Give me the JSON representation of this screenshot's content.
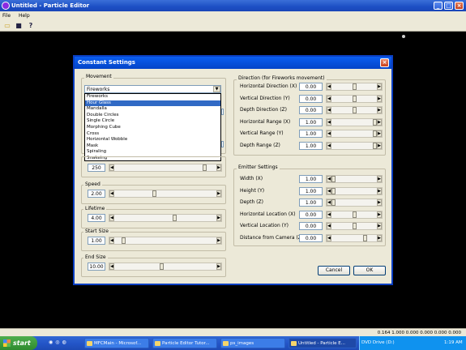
{
  "window": {
    "title": "Untitled - Particle Editor",
    "menu": [
      "File",
      "Help"
    ]
  },
  "toolbar": {
    "icons": [
      "open-icon",
      "save-icon",
      "help-icon"
    ]
  },
  "statusbar": {
    "text": "0.164 1.000 0.000 0.000 0.000 0.000"
  },
  "dialog": {
    "title": "Constant Settings",
    "movement": {
      "label": "Movement",
      "selected": "Fireworks",
      "options": [
        "Fireworks",
        "Hour Glass",
        "Mandalla",
        "Double Circles",
        "Single Circle",
        "Morphing Cube",
        "Cross",
        "Horizontal Wobble",
        "Mask",
        "Spiraling",
        "Snakeing"
      ],
      "highlighted": "Hour Glass"
    },
    "hidden_group_value": "250",
    "speed": {
      "label": "Speed",
      "value": "2.00"
    },
    "lifetime": {
      "label": "Lifetime",
      "value": "4.00"
    },
    "start_size": {
      "label": "Start Size",
      "value": "1.00"
    },
    "end_size": {
      "label": "End Size",
      "value": "10.00"
    },
    "direction": {
      "label": "Direction (for Fireworks movement)",
      "rows": [
        {
          "label": "Horizontal Direction (X)",
          "value": "0.00"
        },
        {
          "label": "Vertical Direction (Y)",
          "value": "0.00"
        },
        {
          "label": "Depth Direction (Z)",
          "value": "0.00"
        },
        {
          "label": "Horizontal Range (X)",
          "value": "1.00"
        },
        {
          "label": "Vertical Range (Y)",
          "value": "1.00"
        },
        {
          "label": "Depth Range (Z)",
          "value": "1.00"
        }
      ]
    },
    "emitter": {
      "label": "Emitter Settings",
      "rows": [
        {
          "label": "Width (X)",
          "value": "1.00"
        },
        {
          "label": "Height (Y)",
          "value": "1.00"
        },
        {
          "label": "Depth (Z)",
          "value": "1.00"
        },
        {
          "label": "Horizontal Location (X)",
          "value": "0.00"
        },
        {
          "label": "Vertical Location (Y)",
          "value": "0.00"
        },
        {
          "label": "Distance from Camera (Z)",
          "value": "0.00"
        }
      ]
    },
    "cancel_label": "Cancel",
    "ok_label": "OK"
  },
  "taskbar": {
    "start_label": "start",
    "tasks": [
      "MFCMain - Microsof...",
      "Particle Editor Tutor...",
      "ps_images",
      "Untitled - Particle E..."
    ],
    "tray_text": "DVD Drive (D:)",
    "clock": "1:19 AM"
  }
}
